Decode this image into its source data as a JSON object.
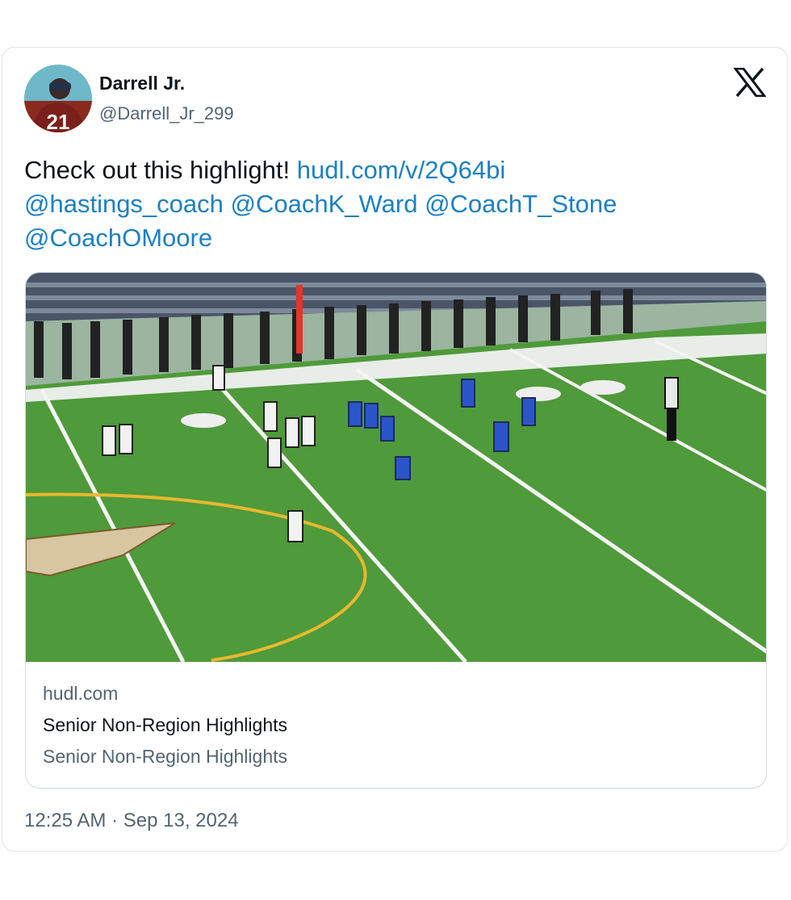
{
  "author": {
    "name": "Darrell Jr.",
    "handle": "@Darrell_Jr_299",
    "avatar_jersey_number": "21"
  },
  "platform_icon": "x-logo-icon",
  "tweet": {
    "text": "Check out this highlight!",
    "link": "hudl.com/v/2Q64bi",
    "mentions": [
      "@hastings_coach",
      "@CoachK_Ward",
      "@CoachT_Stone",
      "@CoachOMoore"
    ]
  },
  "link_card": {
    "image_description_icon": "football-field-image",
    "domain": "hudl.com",
    "title": "Senior Non-Region Highlights",
    "description": "Senior Non-Region Highlights"
  },
  "timestamp": {
    "time": "12:25 AM",
    "separator": "·",
    "date": "Sep 13, 2024"
  },
  "colors": {
    "link": "#1d80c3",
    "secondary_text": "#536471",
    "field_green": "#4f9a3a"
  }
}
